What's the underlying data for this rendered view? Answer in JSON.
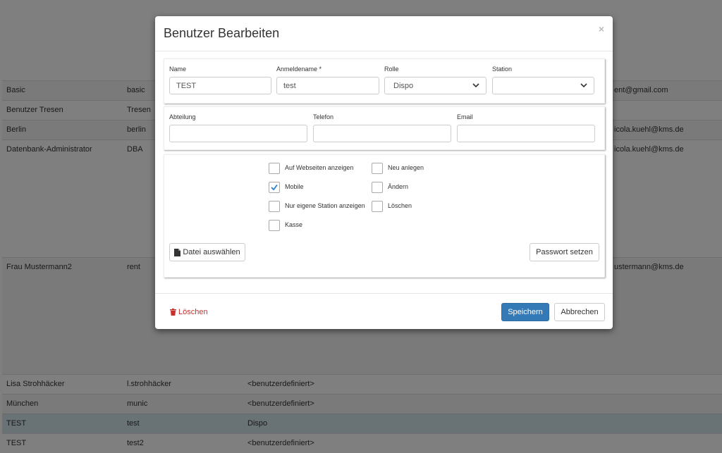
{
  "background_table": {
    "rows": [
      {
        "name": "Basic",
        "login": "basic",
        "role": "",
        "email": "ent@gmail.com"
      },
      {
        "name": "Benutzer Tresen",
        "login": "Tresen",
        "role": "",
        "email": ""
      },
      {
        "name": "Berlin",
        "login": "berlin",
        "role": "",
        "email": "icola.kuehl@kms.de"
      },
      {
        "name": "Datenbank-Administrator",
        "login": "DBA",
        "role": "",
        "email": "icola.kuehl@kms.de"
      },
      {
        "name": "Frau Mustermann2",
        "login": "rent",
        "role": "",
        "email": "ustermann@kms.de"
      },
      {
        "name": "Lisa Strohhäcker",
        "login": "l.strohhäcker",
        "role": "<benutzerdefiniert>",
        "email": ""
      },
      {
        "name": "München",
        "login": "munic",
        "role": "<benutzerdefiniert>",
        "email": ""
      },
      {
        "name": "TEST",
        "login": "test",
        "role": "Dispo",
        "email": ""
      },
      {
        "name": "TEST",
        "login": "test2",
        "role": "<benutzerdefiniert>",
        "email": ""
      }
    ]
  },
  "modal": {
    "title": "Benutzer Bearbeiten",
    "close": "×",
    "fields": {
      "name_label": "Name",
      "name_value": "TEST",
      "login_label": "Anmeldename *",
      "login_value": "test",
      "role_label": "Rolle",
      "role_value": "Dispo",
      "station_label": "Station",
      "station_value": "",
      "department_label": "Abteilung",
      "department_value": "",
      "phone_label": "Telefon",
      "phone_value": "",
      "email_label": "Email",
      "email_value": ""
    },
    "checkboxes": {
      "show_websites": {
        "label": "Auf Webseiten anzeigen",
        "checked": false
      },
      "mobile": {
        "label": "Mobile",
        "checked": true
      },
      "own_station_only": {
        "label": "Nur eigene Station anzeigen",
        "checked": false
      },
      "register": {
        "label": "Kasse",
        "checked": false
      },
      "create": {
        "label": "Neu anlegen",
        "checked": false
      },
      "edit": {
        "label": "Ändern",
        "checked": false
      },
      "delete": {
        "label": "Löschen",
        "checked": false
      }
    },
    "choose_file_label": "Datei auswählen",
    "set_password_label": "Passwort setzen",
    "footer": {
      "delete_label": "Löschen",
      "save_label": "Speichern",
      "cancel_label": "Abbrechen"
    }
  },
  "colors": {
    "primary": "#337ab7",
    "danger": "#c9302c",
    "selected_row": "#d3e5ea",
    "check": "#2a7fc9"
  }
}
